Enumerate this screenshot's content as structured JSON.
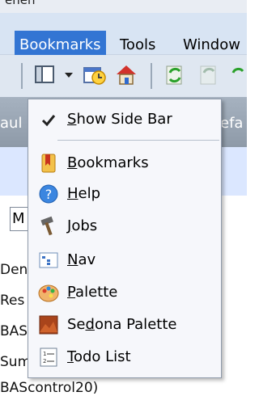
{
  "title_fragment": "enen",
  "menubar": {
    "items": [
      {
        "label": "Bookmarks"
      },
      {
        "label": "Tools"
      },
      {
        "label": "Window"
      }
    ]
  },
  "tabs": {
    "left_fragment": "aul",
    "right_fragment": "efa"
  },
  "content": {
    "search_fragment": "M",
    "lines": [
      "Den",
      "Res",
      "BAS",
      "Sum",
      "BAScontrol20)"
    ]
  },
  "dropdown": {
    "items": [
      {
        "label": "Show Side Bar",
        "checked": true
      },
      {
        "label": "Bookmarks"
      },
      {
        "label": "Help"
      },
      {
        "label": "Jobs"
      },
      {
        "label": "Nav"
      },
      {
        "label": "Palette"
      },
      {
        "label": "Sedona Palette"
      },
      {
        "label": "Todo List"
      }
    ]
  },
  "colors": {
    "menu_highlight": "#3375d3",
    "menubar_bg": "#d8e4f3",
    "dropdown_bg": "#f6f7fb"
  }
}
